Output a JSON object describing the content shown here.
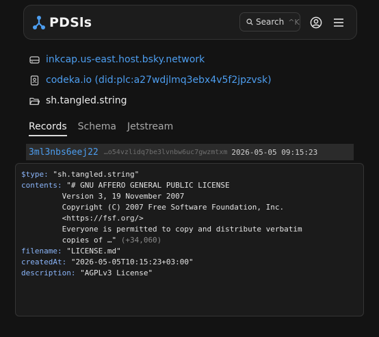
{
  "header": {
    "title": "PDSls",
    "search_label": "Search",
    "search_shortcut": "^K"
  },
  "meta": {
    "pds": "inkcap.us-east.host.bsky.network",
    "repo": "codeka.io (did:plc:a27wdjlmq3ebx4v5f2jpzvsk)",
    "collection": "sh.tangled.string"
  },
  "tabs": [
    "Records",
    "Schema",
    "Jetstream"
  ],
  "record": {
    "rkey": "3ml3nbs6eej22",
    "cid": "…o54vzlidq7be3lvnbw6uc7gwzmtxm",
    "date": "2026-05-05 09:15:23",
    "fields": {
      "type_key": "$type:",
      "type_val": "\"sh.tangled.string\"",
      "contents_key": "contents:",
      "contents_lines": [
        "\"# GNU AFFERO GENERAL PUBLIC LICENSE",
        "",
        "         Version 3, 19 November 2007",
        "",
        "         Copyright (C) 2007 Free Software Foundation, Inc.",
        "         <https://fsf.org/>",
        "",
        "         Everyone is permitted to copy and distribute verbatim",
        "         copies of …\""
      ],
      "contents_more": "(+34,060)",
      "filename_key": "filename:",
      "filename_val": "\"LICENSE.md\"",
      "createdAt_key": "createdAt:",
      "createdAt_val": "\"2026-05-05T10:15:23+03:00\"",
      "description_key": "description:",
      "description_val": "\"AGPLv3 License\""
    }
  }
}
